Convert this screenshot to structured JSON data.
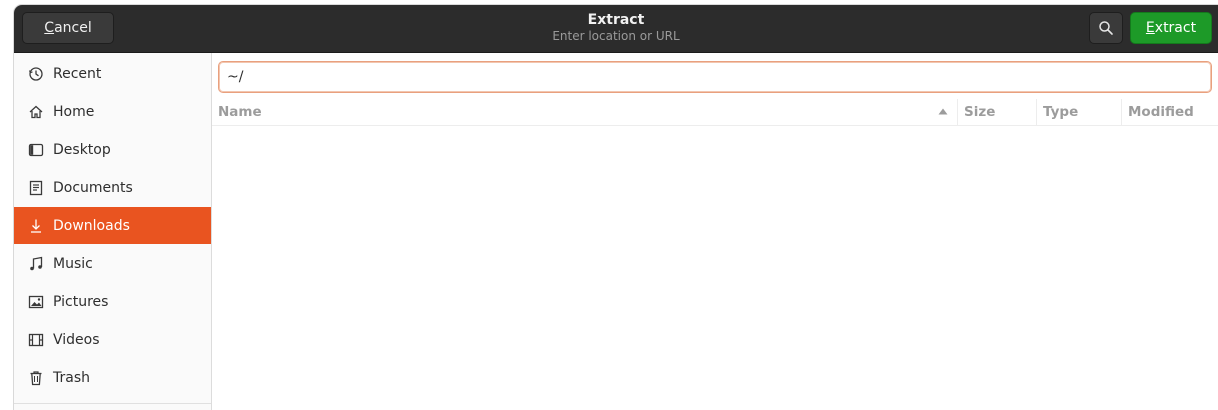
{
  "header": {
    "cancel_label": "Cancel",
    "title": "Extract",
    "subtitle": "Enter location or URL",
    "extract_label": "Extract",
    "search_icon": "search-icon"
  },
  "sidebar": {
    "active": "Downloads",
    "items": [
      {
        "label": "Recent",
        "icon": "clock-icon"
      },
      {
        "label": "Home",
        "icon": "home-icon"
      },
      {
        "label": "Desktop",
        "icon": "desktop-icon"
      },
      {
        "label": "Documents",
        "icon": "document-icon"
      },
      {
        "label": "Downloads",
        "icon": "download-icon"
      },
      {
        "label": "Music",
        "icon": "music-icon"
      },
      {
        "label": "Pictures",
        "icon": "picture-icon"
      },
      {
        "label": "Videos",
        "icon": "video-icon"
      },
      {
        "label": "Trash",
        "icon": "trash-icon"
      }
    ]
  },
  "location": {
    "value": "~/"
  },
  "columns": {
    "name": "Name",
    "size": "Size",
    "type": "Type",
    "modified": "Modified",
    "sort_icon": "sort-ascending-icon"
  },
  "colors": {
    "accent": "#e95420",
    "suggested": "#1d9a28",
    "headerbar": "#2c2c2c"
  }
}
